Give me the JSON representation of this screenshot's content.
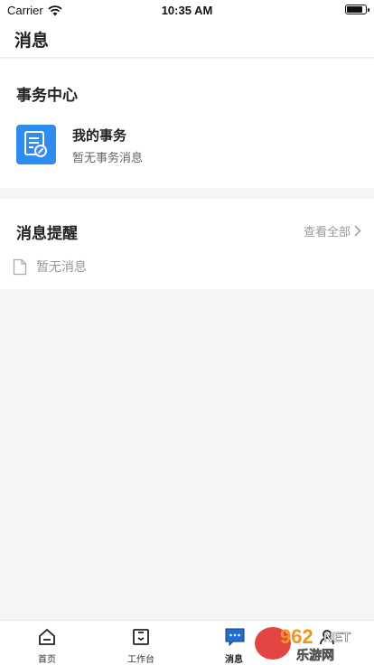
{
  "status_bar": {
    "carrier": "Carrier",
    "time": "10:35 AM"
  },
  "nav": {
    "title": "消息"
  },
  "affairs": {
    "section_title": "事务中心",
    "item_name": "我的事务",
    "item_subtitle": "暂无事务消息",
    "icon": "document-edit-icon",
    "icon_color": "#2f8cf0"
  },
  "messages": {
    "section_title": "消息提醒",
    "view_all": "查看全部",
    "empty_text": "暂无消息"
  },
  "tabs": [
    {
      "label": "首页",
      "icon": "home-icon"
    },
    {
      "label": "工作台",
      "icon": "workbench-icon"
    },
    {
      "label": "消息",
      "icon": "message-icon"
    },
    {
      "label": "",
      "icon": "profile-icon"
    }
  ],
  "watermark": {
    "text_top": "962",
    "text_net": "NET",
    "text_bottom": "乐游网"
  }
}
